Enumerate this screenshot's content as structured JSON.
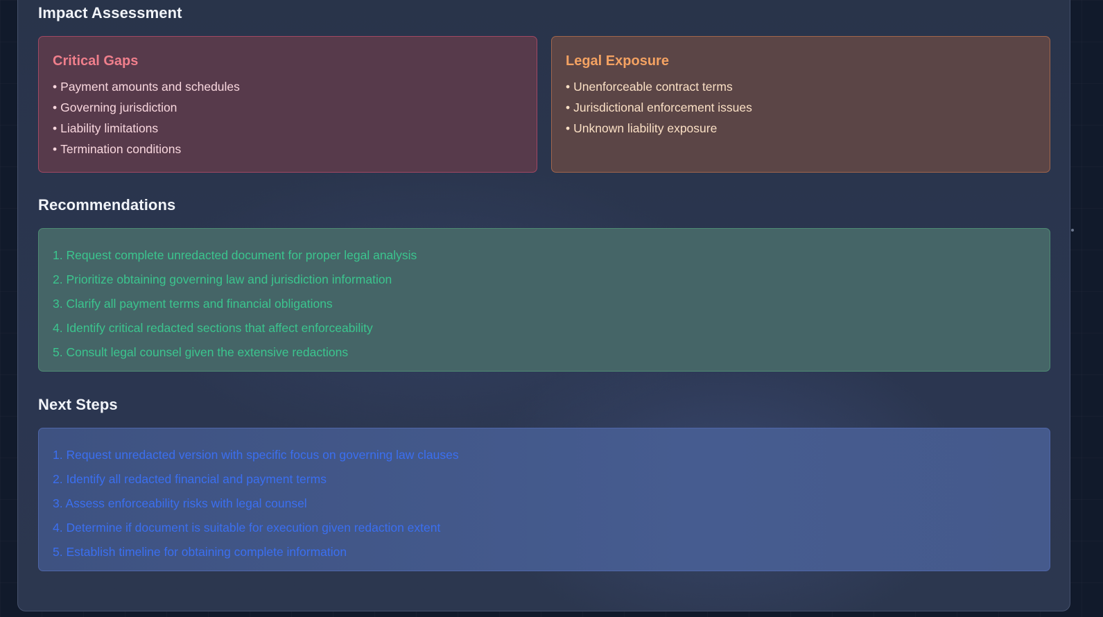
{
  "impact": {
    "title": "Impact Assessment",
    "critical_gaps": {
      "title": "Critical Gaps",
      "items": [
        "Payment amounts and schedules",
        "Governing jurisdiction",
        "Liability limitations",
        "Termination conditions"
      ]
    },
    "legal_exposure": {
      "title": "Legal Exposure",
      "items": [
        "Unenforceable contract terms",
        "Jurisdictional enforcement issues",
        "Unknown liability exposure"
      ]
    },
    "bullet": "•"
  },
  "recommendations": {
    "title": "Recommendations",
    "items": [
      "1. Request complete unredacted document for proper legal analysis",
      "2. Prioritize obtaining governing law and jurisdiction information",
      "3. Clarify all payment terms and financial obligations",
      "4. Identify critical redacted sections that affect enforceability",
      "5. Consult legal counsel given the extensive redactions"
    ]
  },
  "next_steps": {
    "title": "Next Steps",
    "items": [
      "1. Request unredacted version with specific focus on governing law clauses",
      "2. Identify all redacted financial and payment terms",
      "3. Assess enforceability risks with legal counsel",
      "4. Determine if document is suitable for execution given redaction extent",
      "5. Establish timeline for obtaining complete information"
    ]
  },
  "colors": {
    "critical_accent": "#f07f8c",
    "legal_accent": "#f4a262",
    "recommendation_text": "#3bc58e",
    "next_steps_text": "#3b6ff0"
  }
}
